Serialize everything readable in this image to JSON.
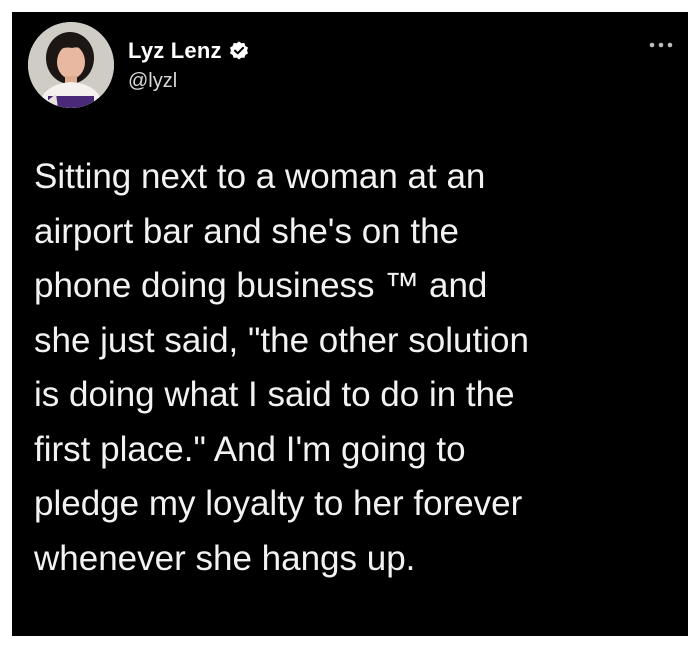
{
  "tweet": {
    "author": {
      "display_name": "Lyz Lenz",
      "handle": "@lyzl",
      "verified": true,
      "avatar_icon": "profile-photo"
    },
    "menu_icon": "more-horizontal-icon",
    "text": "Sitting next to a woman at an\nairport bar and she's on the\nphone doing business ™ and\nshe just said, \"the other solution\nis doing what I said to do in the\nfirst place.\" And I'm going to\npledge my loyalty to her forever\nwhenever she hangs up."
  },
  "colors": {
    "background": "#000000",
    "text": "#f2f2f2",
    "handle": "#d8d8d8",
    "verified_badge": "#ffffff"
  }
}
